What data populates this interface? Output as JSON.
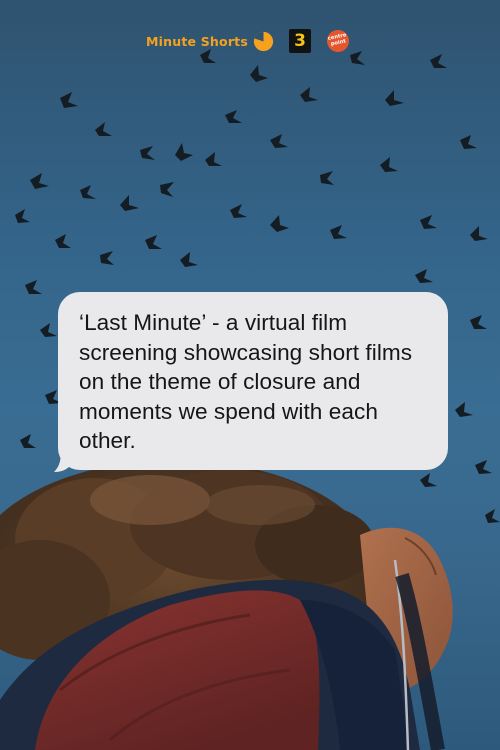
{
  "logos": {
    "brand_name": "Minute Shorts",
    "brand_icon": "orange-clock-pie-icon",
    "b_mark": "3",
    "centrepoint_line1": "centre",
    "centrepoint_line2": "point"
  },
  "message": {
    "text": "‘Last Minute’ - a virtual film screening showcasing short films on the theme of closure and moments we spend with each other."
  },
  "colors": {
    "sky_blue": "#336388",
    "brand_orange": "#f6a21e",
    "b_logo_yellow": "#f4c318",
    "centrepoint_red": "#e4572e",
    "bubble_gray": "#e9e9eb",
    "jacket_red": "#7a2d2a",
    "jacket_navy": "#1d2a3f"
  }
}
